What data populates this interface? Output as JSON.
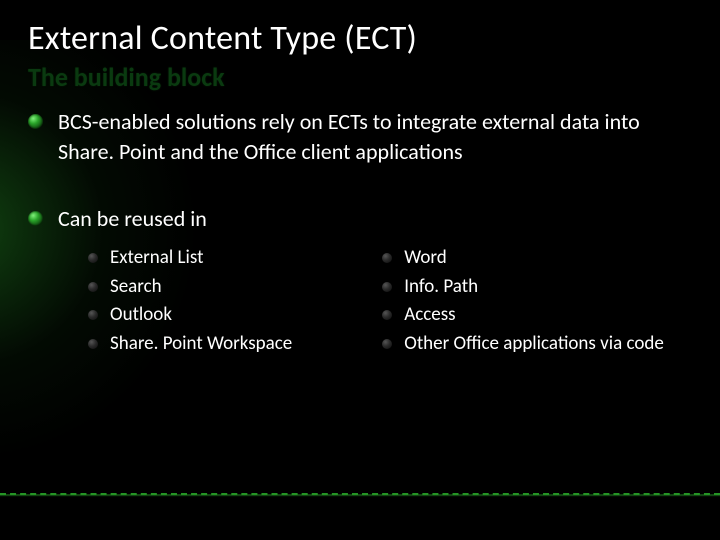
{
  "title": "External Content Type (ECT)",
  "subtitle": "The building block",
  "points": [
    {
      "text": "BCS-enabled solutions rely on ECTs to integrate external data into Share. Point and the Office client applications"
    },
    {
      "text": "Can be reused in",
      "left": [
        "External List",
        "Search",
        "Outlook",
        "Share. Point Workspace"
      ],
      "right": [
        "Word",
        "Info. Path",
        "Access",
        "Other Office applications via code"
      ]
    }
  ]
}
